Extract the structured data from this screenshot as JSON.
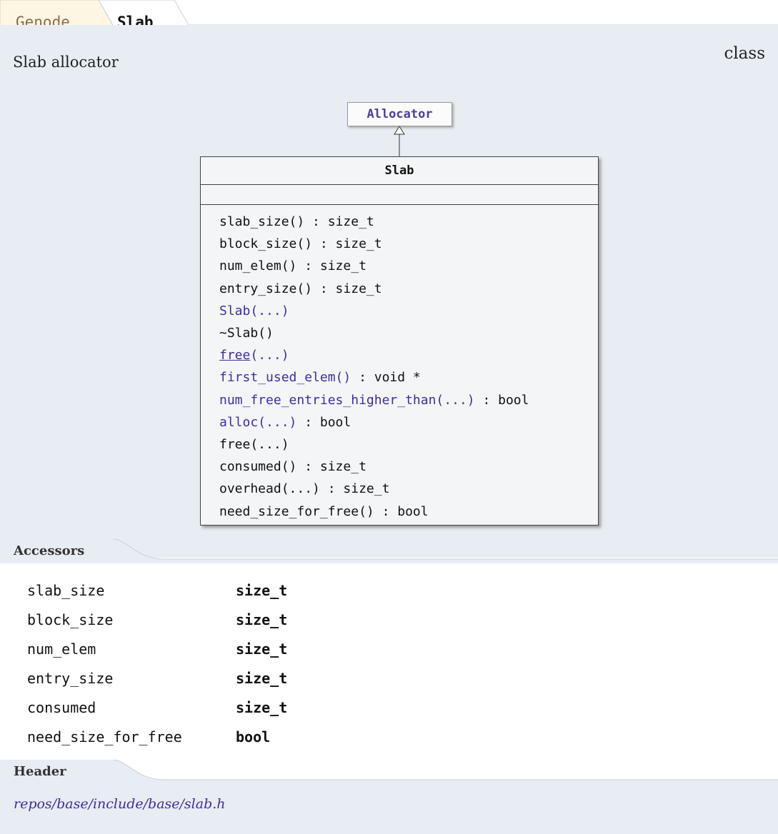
{
  "breadcrumb": {
    "items": [
      {
        "label": "Genode"
      },
      {
        "label": "Slab"
      }
    ]
  },
  "class_summary": "Slab allocator",
  "kind_label": "class",
  "diagram": {
    "base_class": "Allocator",
    "class_name": "Slab",
    "operations": [
      {
        "name": "slab_size()",
        "return": " : size_t",
        "linked": false
      },
      {
        "name": "block_size()",
        "return": " : size_t",
        "linked": false
      },
      {
        "name": "num_elem()",
        "return": " : size_t",
        "linked": false
      },
      {
        "name": "entry_size()",
        "return": " : size_t",
        "linked": false
      },
      {
        "name": "Slab(...)",
        "return": "",
        "linked": true
      },
      {
        "name": "~Slab()",
        "return": "",
        "linked": false
      },
      {
        "name": "free(...)",
        "return": "",
        "linked": true,
        "underline_part": "free"
      },
      {
        "name": "first_used_elem()",
        "return": " : void *",
        "linked": true
      },
      {
        "name": "num_free_entries_higher_than(...)",
        "return": " : bool",
        "linked": true
      },
      {
        "name": "alloc(...)",
        "return": " : bool",
        "linked": true
      },
      {
        "name": "free(...)",
        "return": "",
        "linked": false
      },
      {
        "name": "consumed()",
        "return": " : size_t",
        "linked": false
      },
      {
        "name": "overhead(...)",
        "return": " : size_t",
        "linked": false
      },
      {
        "name": "need_size_for_free()",
        "return": " : bool",
        "linked": false
      }
    ]
  },
  "accessors": {
    "title": "Accessors",
    "rows": [
      {
        "name": "slab_size",
        "type": "size_t"
      },
      {
        "name": "block_size",
        "type": "size_t"
      },
      {
        "name": "num_elem",
        "type": "size_t"
      },
      {
        "name": "entry_size",
        "type": "size_t"
      },
      {
        "name": "consumed",
        "type": "size_t"
      },
      {
        "name": "need_size_for_free",
        "type": "bool"
      }
    ]
  },
  "header": {
    "title": "Header",
    "path": "repos/base/include/base/slab.h"
  },
  "colors": {
    "panel": "#e8ecf3",
    "link": "#3b2fa0",
    "crumb_first_bg": "#fdf6e3",
    "crumb_first_text": "#8a6d4a"
  }
}
